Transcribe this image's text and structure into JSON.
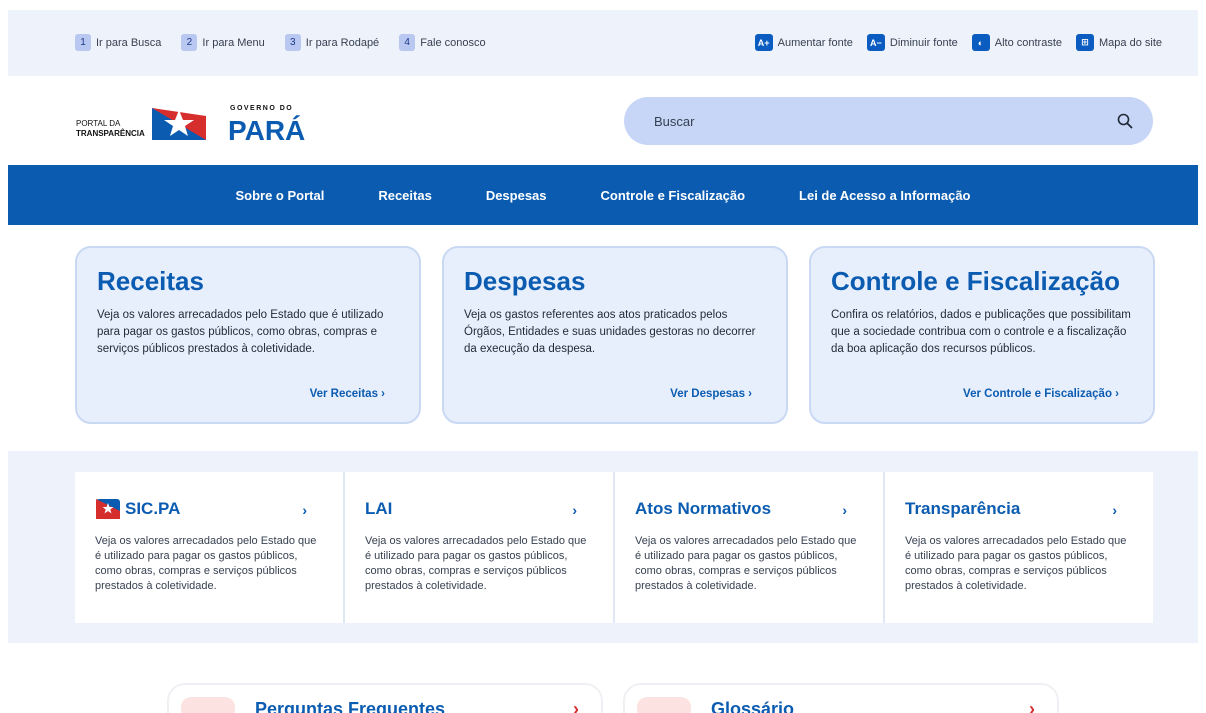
{
  "accessibility": {
    "skip_links": [
      {
        "num": "1",
        "label": "Ir para Busca"
      },
      {
        "num": "2",
        "label": "Ir para Menu"
      },
      {
        "num": "3",
        "label": "Ir para Rodapé"
      },
      {
        "num": "4",
        "label": "Fale conosco"
      }
    ],
    "tools": [
      {
        "icon": "A+",
        "label": "Aumentar fonte"
      },
      {
        "icon": "A−",
        "label": "Diminuir fonte"
      },
      {
        "icon": "◐",
        "label": "Alto contraste"
      },
      {
        "icon": "⊞",
        "label": "Mapa do site"
      }
    ]
  },
  "logo": {
    "line1": "PORTAL DA",
    "line2": "TRANSPARÊNCIA",
    "gov": "GOVERNO DO",
    "state": "PARÁ"
  },
  "search": {
    "placeholder": "Buscar"
  },
  "nav": {
    "items": [
      "Sobre o Portal",
      "Receitas",
      "Despesas",
      "Controle e Fiscalização",
      "Lei de Acesso a Informação"
    ]
  },
  "cards": [
    {
      "title": "Receitas",
      "text": "Veja os valores arrecadados pelo Estado que é utilizado para pagar os gastos públicos, como obras, compras e serviços públicos prestados à coletividade.",
      "link": "Ver Receitas  ›"
    },
    {
      "title": "Despesas",
      "text": "Veja os gastos referentes aos atos praticados pelos Órgãos, Entidades e suas unidades gestoras no decorrer da execução da despesa.",
      "link": "Ver Despesas  ›"
    },
    {
      "title": "Controle e Fiscalização",
      "text": "Confira os relatórios, dados e publicações que possibilitam que a sociedade contribua com o controle e a fiscalização da boa aplicação dos recursos públicos.",
      "link": "Ver Controle e Fiscalização  ›"
    }
  ],
  "tiles": [
    {
      "title": "SIC.PA",
      "text": "Veja os valores arrecadados pelo Estado que é utilizado para pagar os gastos públicos, como obras, compras e serviços públicos prestados à coletividade."
    },
    {
      "title": "LAI",
      "text": "Veja os valores arrecadados pelo Estado que é utilizado para pagar os gastos públicos, como obras, compras e serviços públicos prestados à coletividade."
    },
    {
      "title": "Atos Normativos",
      "text": "Veja os valores arrecadados pelo Estado que é utilizado para pagar os gastos públicos, como obras, compras e serviços públicos prestados à coletividade."
    },
    {
      "title": "Transparência",
      "text": "Veja os valores arrecadados pelo Estado que é utilizado para pagar os gastos públicos, como obras, compras e serviços públicos prestados à coletividade."
    }
  ],
  "bottom_cards": [
    {
      "title": "Perguntas Frequentes"
    },
    {
      "title": "Glossário"
    }
  ],
  "colors": {
    "primary": "#0b5cb1",
    "light_bg": "#eef2fb",
    "accent_red": "#d62d2d"
  }
}
